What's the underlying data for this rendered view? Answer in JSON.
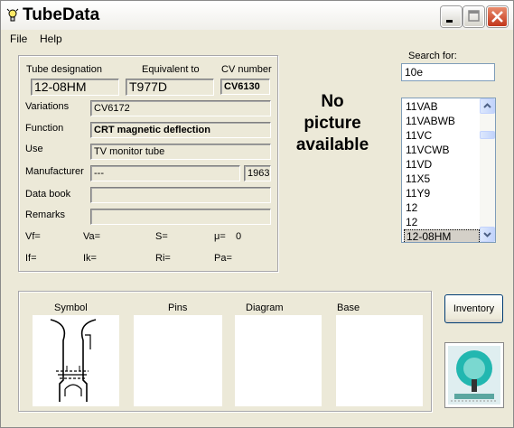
{
  "window": {
    "title": "TubeData"
  },
  "menu": {
    "file": "File",
    "help": "Help"
  },
  "details": {
    "designation_label": "Tube designation",
    "designation_value": "12-08HM",
    "equivalent_label": "Equivalent to",
    "equivalent_value": "T977D",
    "cv_label": "CV number",
    "cv_value": "CV6130",
    "variations_label": "Variations",
    "variations_value": "CV6172",
    "function_label": "Function",
    "function_value": "CRT magnetic deflection",
    "use_label": "Use",
    "use_value": "TV monitor tube",
    "manufacturer_label": "Manufacturer",
    "manufacturer_value": "---",
    "year_value": "1963",
    "databook_label": "Data book",
    "databook_value": "",
    "remarks_label": "Remarks",
    "remarks_value": ""
  },
  "params": {
    "vf": "Vf=",
    "va": "Va=",
    "s": "S=",
    "mu": "μ=",
    "mu_value": "0",
    "if": "If=",
    "ik": "Ik=",
    "ri": "Ri=",
    "pa": "Pa="
  },
  "picture": {
    "line1": "No",
    "line2": "picture",
    "line3": "available"
  },
  "search": {
    "label": "Search for:",
    "value": "10e"
  },
  "tube_list": {
    "items": [
      "11VAB",
      "11VABWB",
      "11VC",
      "11VCWB",
      "11VD",
      "11X5",
      "11Y9",
      "12",
      "12",
      "12-08HM"
    ],
    "selected": "12-08HM"
  },
  "images": {
    "symbol": "Symbol",
    "pins": "Pins",
    "diagram": "Diagram",
    "base": "Base"
  },
  "buttons": {
    "inventory": "Inventory"
  },
  "icons": {
    "app": "lightbulb-icon",
    "minimize": "minimize-icon",
    "maximize": "maximize-icon",
    "close": "close-icon",
    "scroll_up": "arrow-up-icon",
    "scroll_down": "arrow-down-icon",
    "logo": "tube-logo"
  },
  "colors": {
    "window_bg": "#ece9d8",
    "close_button": "#c2361b",
    "list_border": "#7f9db9"
  }
}
